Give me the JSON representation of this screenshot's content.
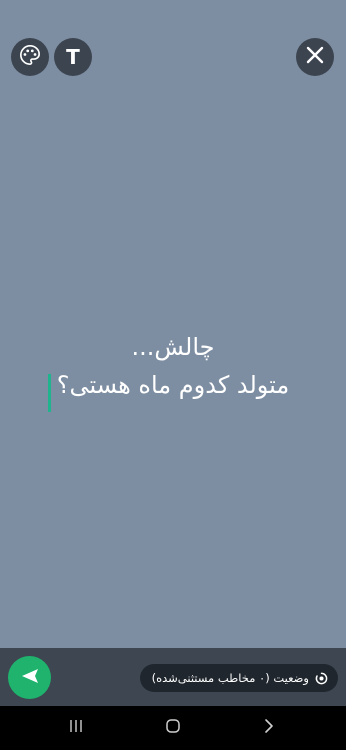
{
  "toolbar": {
    "text_tool_label": "T",
    "icons": [
      "palette-icon",
      "close-icon"
    ]
  },
  "status": {
    "line1": "چالش...",
    "line2": "متولد کدوم ماه هستی؟"
  },
  "bottom": {
    "privacy_label": "وضعیت (۰ مخاطب مستثنی‌شده)",
    "send_icon": "send-icon"
  },
  "colors": {
    "background": "#7d8ea2",
    "accent": "#1fb36d",
    "caret": "#1fb48e",
    "bar": "#3d4651"
  },
  "nav": {
    "icons": [
      "recent-apps-icon",
      "home-icon",
      "back-icon"
    ]
  }
}
